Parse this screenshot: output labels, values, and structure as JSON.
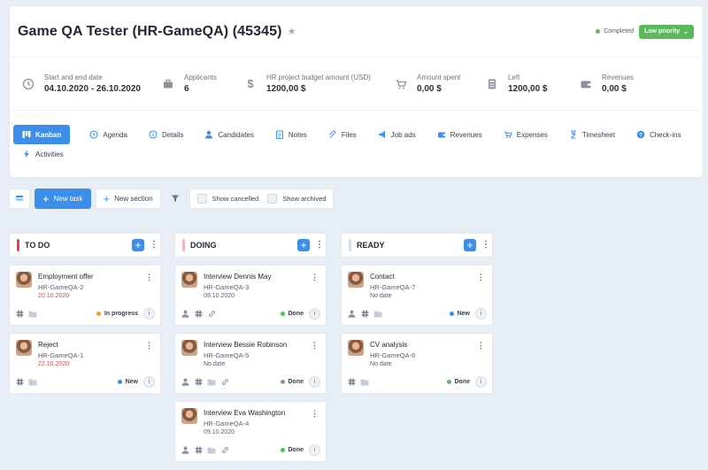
{
  "header": {
    "title": "Game QA Tester  (HR-GameQA) (45345)",
    "status": {
      "label": "Completed",
      "color": "#5cb85c"
    },
    "priority": {
      "label": "Low priority",
      "color": "#5cb85c"
    }
  },
  "stats": [
    {
      "icon": "clock-icon",
      "label": "Start and end date",
      "value": "04.10.2020 - 26.10.2020"
    },
    {
      "icon": "briefcase-icon",
      "label": "Applicants",
      "value": "6"
    },
    {
      "icon": "dollar-icon",
      "label": "HR project budget amount (USD)",
      "value": "1200,00 $"
    },
    {
      "icon": "cart-icon",
      "label": "Amount spent",
      "value": "0,00 $"
    },
    {
      "icon": "calculator-icon",
      "label": "Left",
      "value": "1200,00 $"
    },
    {
      "icon": "wallet-icon",
      "label": "Revenues",
      "value": "0,00 $"
    }
  ],
  "tabs": [
    {
      "label": "Kanban",
      "icon": "kanban-icon",
      "active": true
    },
    {
      "label": "Agenda",
      "icon": "agenda-icon"
    },
    {
      "label": "Details",
      "icon": "details-icon"
    },
    {
      "label": "Candidates",
      "icon": "candidates-icon"
    },
    {
      "label": "Notes",
      "icon": "notes-icon"
    },
    {
      "label": "Files",
      "icon": "files-icon"
    },
    {
      "label": "Job ads",
      "icon": "megaphone-icon"
    },
    {
      "label": "Revenues",
      "icon": "wallet-icon"
    },
    {
      "label": "Expenses",
      "icon": "cart-icon"
    },
    {
      "label": "Timesheet",
      "icon": "hourglass-icon"
    },
    {
      "label": "Check-ins",
      "icon": "help-icon"
    },
    {
      "label": "Activities",
      "icon": "lightning-icon"
    }
  ],
  "toolbar": {
    "new_task": "New task",
    "new_section": "New section",
    "show_cancelled": "Show cancelled",
    "show_archived": "Show archived"
  },
  "colors": {
    "accent": "#3b8fe8",
    "todo": "#e0434b",
    "doing": "#f4b6b6",
    "ready": "#d6dcf5",
    "in_progress": "#f0a020",
    "new": "#3b8fe8",
    "done": "#5cb85c"
  },
  "columns": [
    {
      "title": "TO DO",
      "cards": [
        {
          "title": "Employment offer",
          "code": "HR-GameQA-2",
          "date": "20.10.2020",
          "status": "In progress"
        },
        {
          "title": "Reject",
          "code": "HR-GameQA-1",
          "date": "22.10.2020",
          "status": "New"
        }
      ]
    },
    {
      "title": "DOING",
      "cards": [
        {
          "title": "Interview Dennis May",
          "code": "HR-GameQA-3",
          "date": "09.10.2020",
          "status": "Done"
        },
        {
          "title": "Interview Bessie Robinson",
          "code": "HR-GameQA-5",
          "date": "No date",
          "status": "Done"
        },
        {
          "title": "Interview Eva Washington",
          "code": "HR-GameQA-4",
          "date": "09.10.2020",
          "status": "Done"
        }
      ]
    },
    {
      "title": "READY",
      "cards": [
        {
          "title": "Contact",
          "code": "HR-GameQA-7",
          "date": "No date",
          "status": "New"
        },
        {
          "title": "CV analysis",
          "code": "HR-GameQA-6",
          "date": "No date",
          "status": "Done"
        }
      ]
    }
  ]
}
